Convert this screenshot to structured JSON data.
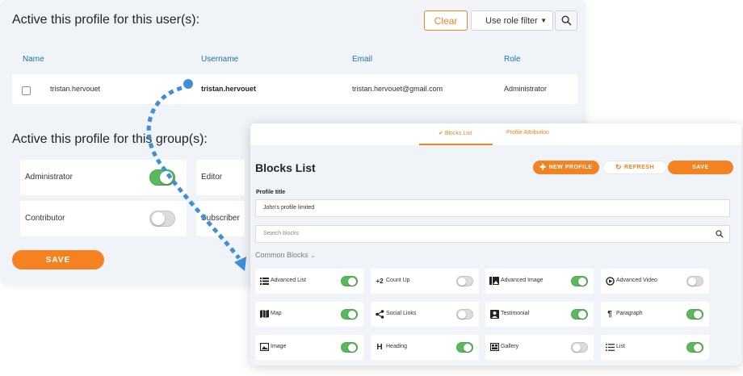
{
  "users_panel": {
    "title": "Active this profile for this user(s):",
    "clear_label": "Clear",
    "role_filter_label": "Use role filter",
    "columns": [
      "Name",
      "Username",
      "Email",
      "Role"
    ],
    "rows": [
      {
        "name": "tristan.hervouet",
        "username": "tristan.hervouet",
        "email": "tristan.hervouet@gmail.com",
        "role": "Administrator"
      }
    ]
  },
  "groups_panel": {
    "title": "Active this profile for this group(s):",
    "groups": [
      {
        "label": "Administrator",
        "enabled": true
      },
      {
        "label": "Editor"
      },
      {
        "label": "Contributor",
        "enabled": false
      },
      {
        "label": "Subscriber"
      }
    ],
    "save_label": "SAVE"
  },
  "blocks_panel": {
    "tabs": [
      {
        "label": "Blocks List",
        "active": true
      },
      {
        "label": "Profile Attribution",
        "active": false
      }
    ],
    "title": "Blocks List",
    "new_profile_label": "NEW PROFILE",
    "refresh_label": "REFRESH",
    "save_label": "SAVE",
    "profile_title_label": "Profile title",
    "profile_title_value": "John's profile limited",
    "search_placeholder": "Search blocks",
    "category_label": "Common Blocks",
    "blocks": [
      {
        "label": "Advanced List",
        "icon": "list-icon",
        "enabled": true
      },
      {
        "label": "Count Up",
        "icon": "count-up-icon",
        "enabled": false
      },
      {
        "label": "Advanced Image",
        "icon": "image-gallery-icon",
        "enabled": true
      },
      {
        "label": "Advanced Video",
        "icon": "play-icon",
        "enabled": false
      },
      {
        "label": "Map",
        "icon": "map-icon",
        "enabled": true
      },
      {
        "label": "Social Links",
        "icon": "share-icon",
        "enabled": false
      },
      {
        "label": "Testimonial",
        "icon": "person-icon",
        "enabled": true
      },
      {
        "label": "Paragraph",
        "icon": "paragraph-icon",
        "enabled": true
      },
      {
        "label": "Image",
        "icon": "image-icon",
        "enabled": true
      },
      {
        "label": "Heading",
        "icon": "heading-icon",
        "enabled": true
      },
      {
        "label": "Gallery",
        "icon": "gallery-icon",
        "enabled": false
      },
      {
        "label": "List",
        "icon": "list-icon",
        "enabled": true
      }
    ]
  },
  "colors": {
    "accent": "#f58220",
    "toggle_on": "#5cb85c",
    "link": "#2271b1",
    "arrow": "#3f8fd6"
  }
}
